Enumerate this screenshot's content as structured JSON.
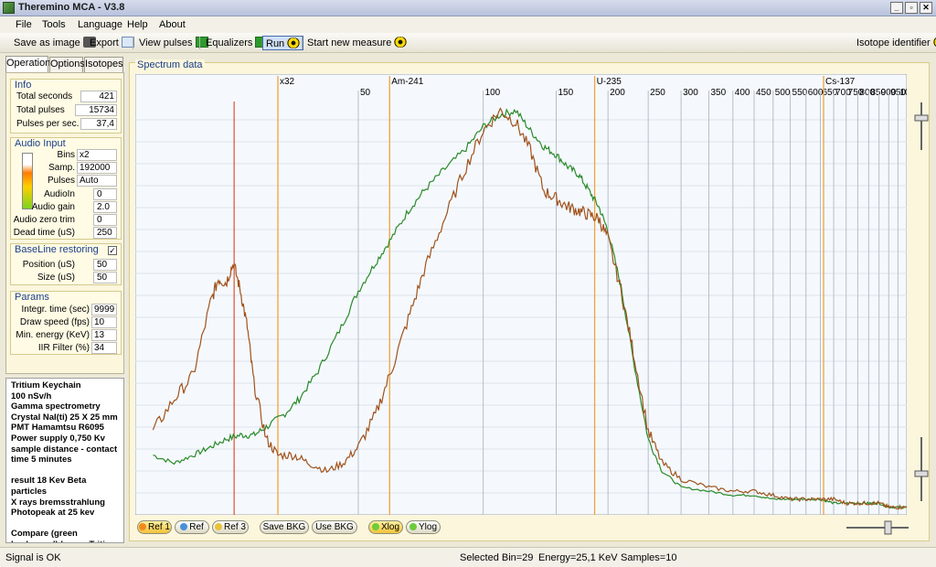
{
  "window": {
    "title": "Theremino MCA - V3.8",
    "buttons": [
      "_",
      "▫",
      "✕"
    ]
  },
  "menu": [
    "File",
    "Tools",
    "Language",
    "Help",
    "About"
  ],
  "toolbar": {
    "save_image": "Save as image",
    "export": "Export",
    "view_pulses": "View pulses",
    "equalizers": "Equalizers",
    "run": "Run",
    "start_new": "Start new measure",
    "isotope_identifier": "Isotope identifier"
  },
  "tabs": [
    "Operation",
    "Options",
    "Isotopes"
  ],
  "info": {
    "title": "Info",
    "total_seconds_label": "Total seconds",
    "total_seconds": "421",
    "total_pulses_label": "Total pulses",
    "total_pulses": "15734",
    "pps_label": "Pulses per sec.",
    "pps": "37,4"
  },
  "audio": {
    "title": "Audio Input",
    "bins_label": "Bins",
    "bins": "x2",
    "samp_label": "Samp.",
    "samp": "192000",
    "pulses_label": "Pulses",
    "pulses": "Auto",
    "audioin_label": "AudioIn",
    "audioin": "0",
    "gain_label": "Audio gain",
    "gain": "2.0",
    "zero_label": "Audio zero trim",
    "zero": "0",
    "dead_label": "Dead time (uS)",
    "dead": "250"
  },
  "baseline": {
    "title": "BaseLine restoring",
    "checked": "✓",
    "position_label": "Position (uS)",
    "position": "50",
    "size_label": "Size (uS)",
    "size": "50"
  },
  "params": {
    "title": "Params",
    "integr_label": "Integr. time (sec)",
    "integr": "9999",
    "speed_label": "Draw speed (fps)",
    "speed": "10",
    "minenergy_label": "Min. energy (KeV)",
    "minenergy": "13",
    "iir_label": "IIR Filter (%)",
    "iir": "34"
  },
  "notes": "Tritium Keychain\n100 nSv/h\nGamma spectrometry\nCrystal NaI(ti) 25 X 25 mm\nPMT Hamamtsu R6095\nPower supply 0,750 Kv\nsample distance - contact\ntime 5 minutes\n\nresult 18 Kev Beta particles\nX rays bremsstrahlung\nPhotopeak at 25 kev\n\nCompare (green backround) brown Tritium",
  "spectrum": {
    "title": "Spectrum data",
    "isotopes": [
      {
        "name": "x32",
        "kev": 32
      },
      {
        "name": "Am-241",
        "kev": 59.5
      },
      {
        "name": "U-235",
        "kev": 185.7
      },
      {
        "name": "Cs-137",
        "kev": 661.7
      }
    ],
    "cursor_kev": 25.1,
    "colors": {
      "brown": "#a0521c",
      "green": "#2a8a2a",
      "isotope": "#f2a23a",
      "cursor": "#e05030",
      "grid": "#b8bec8",
      "background": "#f5f9fd"
    }
  },
  "chart_data": {
    "type": "line",
    "title": "",
    "xlabel": "",
    "ylabel": "",
    "x_scale": "log",
    "xlim": [
      14.5,
      1050
    ],
    "xticks": [
      50,
      100,
      150,
      200,
      250,
      300,
      350,
      400,
      450,
      500,
      550,
      600,
      650,
      700,
      750,
      800,
      850,
      900,
      950,
      1000
    ],
    "ylim": [
      0,
      100
    ],
    "series": [
      {
        "color": "#a0521c",
        "points": [
          [
            16,
            20
          ],
          [
            18,
            28
          ],
          [
            20,
            34
          ],
          [
            22,
            52
          ],
          [
            23,
            58
          ],
          [
            24,
            57
          ],
          [
            25,
            62
          ],
          [
            26,
            55
          ],
          [
            27,
            46
          ],
          [
            28,
            32
          ],
          [
            30,
            18
          ],
          [
            32,
            14
          ],
          [
            35,
            14
          ],
          [
            38,
            12
          ],
          [
            42,
            10
          ],
          [
            46,
            12
          ],
          [
            50,
            16
          ],
          [
            55,
            24
          ],
          [
            60,
            35
          ],
          [
            66,
            48
          ],
          [
            72,
            60
          ],
          [
            80,
            72
          ],
          [
            90,
            85
          ],
          [
            100,
            95
          ],
          [
            110,
            100
          ],
          [
            120,
            97
          ],
          [
            130,
            90
          ],
          [
            140,
            80
          ],
          [
            150,
            78
          ],
          [
            160,
            76
          ],
          [
            170,
            75
          ],
          [
            180,
            74
          ],
          [
            190,
            73
          ],
          [
            200,
            68
          ],
          [
            215,
            55
          ],
          [
            230,
            40
          ],
          [
            250,
            20
          ],
          [
            270,
            12
          ],
          [
            300,
            8
          ],
          [
            350,
            6
          ],
          [
            400,
            5
          ],
          [
            450,
            5
          ],
          [
            500,
            4
          ],
          [
            550,
            3
          ],
          [
            600,
            3
          ],
          [
            650,
            3
          ],
          [
            700,
            3
          ],
          [
            750,
            2
          ],
          [
            800,
            2
          ],
          [
            850,
            2
          ],
          [
            900,
            2
          ],
          [
            950,
            1
          ],
          [
            1000,
            1
          ],
          [
            1050,
            1
          ]
        ]
      },
      {
        "color": "#2a8a2a",
        "points": [
          [
            16,
            14
          ],
          [
            18,
            12
          ],
          [
            20,
            14
          ],
          [
            22,
            16
          ],
          [
            24,
            18
          ],
          [
            26,
            19
          ],
          [
            28,
            19
          ],
          [
            30,
            21
          ],
          [
            33,
            24
          ],
          [
            36,
            28
          ],
          [
            40,
            35
          ],
          [
            45,
            45
          ],
          [
            50,
            55
          ],
          [
            55,
            62
          ],
          [
            60,
            68
          ],
          [
            66,
            75
          ],
          [
            72,
            80
          ],
          [
            80,
            85
          ],
          [
            90,
            90
          ],
          [
            100,
            96
          ],
          [
            110,
            99
          ],
          [
            120,
            100
          ],
          [
            130,
            95
          ],
          [
            140,
            91
          ],
          [
            150,
            89
          ],
          [
            160,
            86
          ],
          [
            170,
            84
          ],
          [
            180,
            80
          ],
          [
            190,
            76
          ],
          [
            200,
            70
          ],
          [
            215,
            56
          ],
          [
            230,
            38
          ],
          [
            250,
            18
          ],
          [
            270,
            10
          ],
          [
            300,
            6
          ],
          [
            350,
            5
          ],
          [
            400,
            4
          ],
          [
            450,
            4
          ],
          [
            500,
            3
          ],
          [
            550,
            3
          ],
          [
            600,
            3
          ],
          [
            650,
            3
          ],
          [
            700,
            2
          ],
          [
            750,
            2
          ],
          [
            800,
            2
          ],
          [
            850,
            2
          ],
          [
            900,
            2
          ],
          [
            950,
            1
          ],
          [
            1000,
            1
          ],
          [
            1050,
            1
          ]
        ]
      }
    ]
  },
  "bottom_buttons": {
    "ref1": "Ref 1",
    "ref": "Ref",
    "ref3": "Ref 3",
    "save_bkg": "Save BKG",
    "use_bkg": "Use BKG",
    "xlog": "Xlog",
    "ylog": "Ylog"
  },
  "status": {
    "signal": "Signal is OK",
    "selected_bin": "Selected Bin=29",
    "energy": "Energy=25,1 KeV",
    "samples": "Samples=10"
  }
}
